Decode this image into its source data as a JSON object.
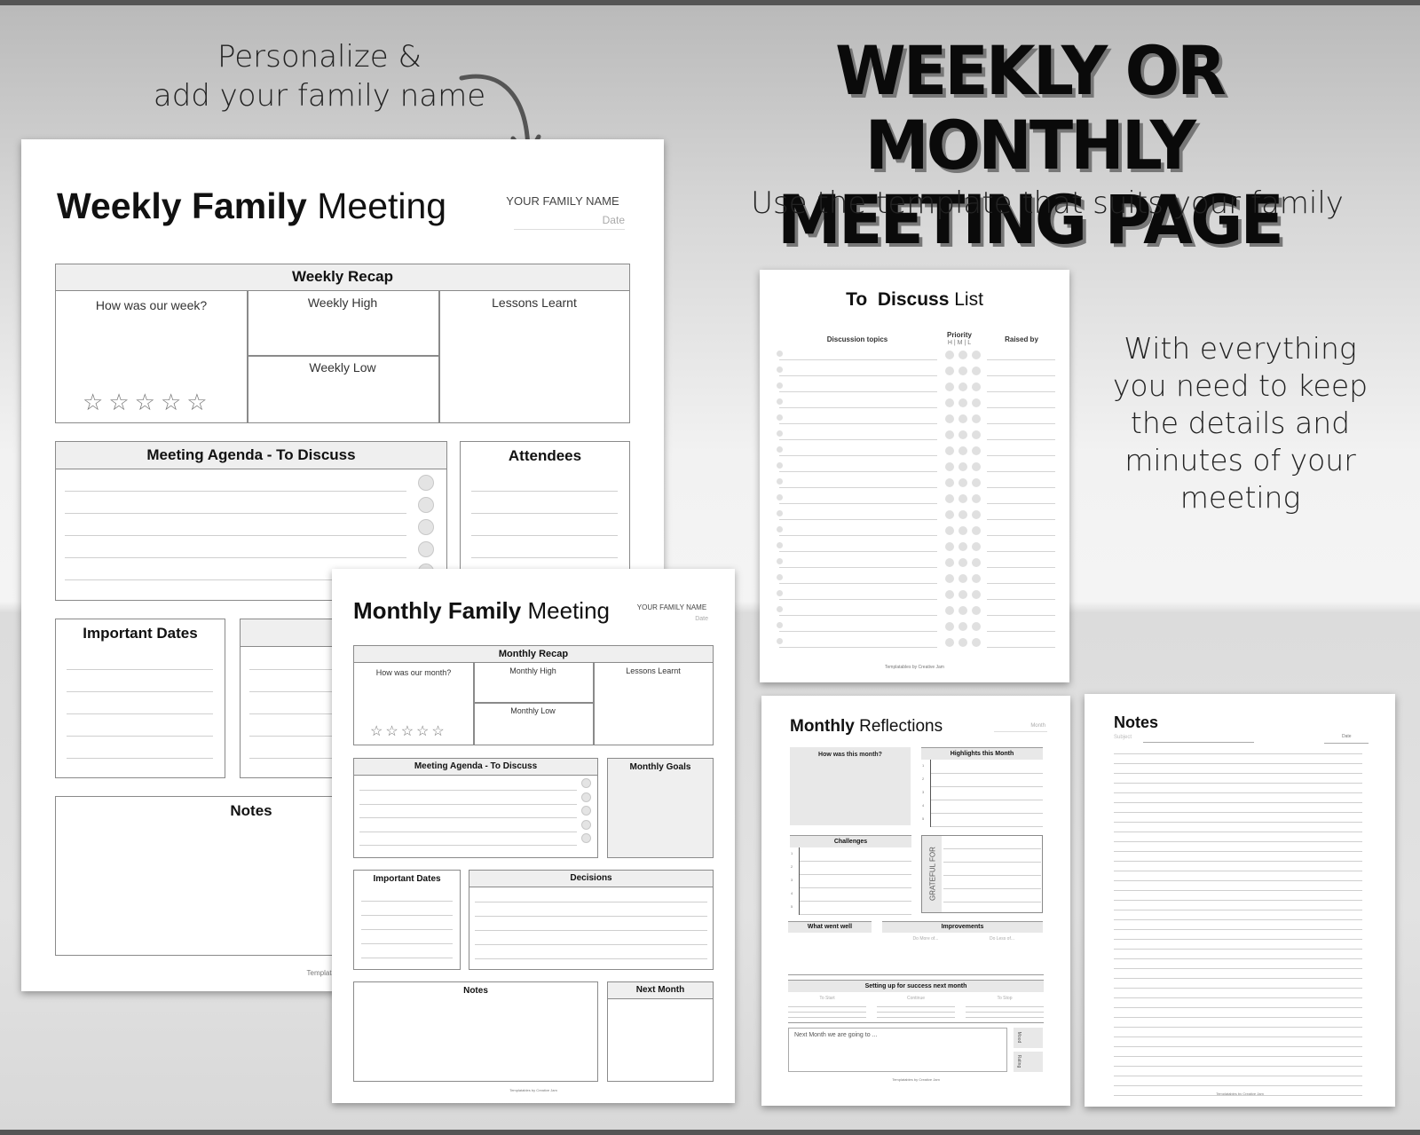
{
  "promo": {
    "personalize_line1": "Personalize &",
    "personalize_line2": "add your family name",
    "headline_line1": "WEEKLY OR MONTHLY",
    "headline_line2": "MEETING PAGE",
    "subheadline": "Use the template that suits your family",
    "side_copy_lines": [
      "With everything",
      "you need to keep",
      "the details and",
      "minutes of your",
      "meeting"
    ]
  },
  "weekly_sheet": {
    "title_bold": "Weekly Family",
    "title_light": "Meeting",
    "family_name_label": "YOUR FAMILY NAME",
    "date_label": "Date",
    "recap": {
      "header": "Weekly Recap",
      "how_label": "How was our week?",
      "high_label": "Weekly High",
      "low_label": "Weekly Low",
      "lessons_label": "Lessons Learnt",
      "rating_stars_total": 5,
      "rating_stars_filled": 0
    },
    "agenda_header": "Meeting Agenda - To Discuss",
    "attendees_header": "Attendees",
    "important_dates_header": "Important Dates",
    "notes_header": "Notes",
    "footer": "Templatab"
  },
  "monthly_sheet": {
    "title_bold": "Monthly Family",
    "title_light": "Meeting",
    "family_name_label": "YOUR FAMILY NAME",
    "date_label": "Date",
    "recap": {
      "header": "Monthly Recap",
      "how_label": "How was our month?",
      "high_label": "Monthly High",
      "low_label": "Monthly Low",
      "lessons_label": "Lessons Learnt",
      "rating_stars_total": 5,
      "rating_stars_filled": 0
    },
    "agenda_header": "Meeting Agenda - To Discuss",
    "goals_header": "Monthly Goals",
    "important_dates_header": "Important Dates",
    "decisions_header": "Decisions",
    "notes_header": "Notes",
    "next_month_header": "Next Month",
    "footer": "Templatables by Creative Jam"
  },
  "discuss_sheet": {
    "title_bold": "To  Discuss",
    "title_light": "List",
    "col_topics": "Discussion topics",
    "col_priority": "Priority",
    "priority_levels": "H | M | L",
    "col_raised_by": "Raised by",
    "row_count": 19,
    "footer": "Templatables by Creative Jam"
  },
  "reflections_sheet": {
    "title_bold": "Monthly",
    "title_light": "Reflections",
    "month_label": "Month",
    "how_header": "How was this month?",
    "highlights_header": "Highlights this Month",
    "highlights_numbers": [
      "1",
      "2",
      "3",
      "4",
      "5"
    ],
    "challenges_header": "Challenges",
    "challenges_numbers": [
      "1",
      "2",
      "3",
      "4",
      "5"
    ],
    "grateful_label": "GRATEFUL FOR",
    "went_well_header": "What went well",
    "improvements_header": "Improvements",
    "do_more_label": "Do More of...",
    "do_less_label": "Do Less of...",
    "success_header": "Setting up for success next month",
    "success_cols": [
      "To Start",
      "Continue",
      "To Stop"
    ],
    "next_month_placeholder": "Next Month we are going to ...",
    "mood_label": "Mood",
    "rating_label": "Rating",
    "footer": "Templatables by Creative Jam"
  },
  "notes_sheet": {
    "title": "Notes",
    "subject_label": "Subject",
    "date_label": "Date",
    "footer": "Templatables by Creative Jam"
  }
}
